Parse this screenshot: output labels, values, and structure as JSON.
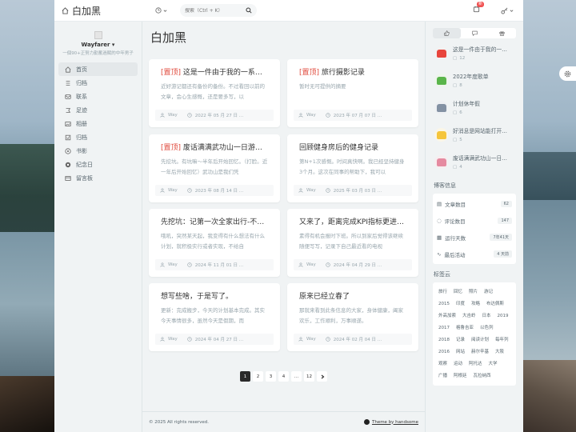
{
  "header": {
    "brand_title": "白加黑",
    "search_placeholder": "搜索（Ctrl + K）",
    "notification_count": "新"
  },
  "profile": {
    "name": "Wayfarer",
    "desc": "一個90+正努力勤奮過賦的中年男子"
  },
  "menu": [
    {
      "label": "首页",
      "icon": "home-icon"
    },
    {
      "label": "归档",
      "icon": "archive-icon"
    },
    {
      "label": "联系",
      "icon": "contact-icon"
    },
    {
      "label": "足迹",
      "icon": "footprint-icon"
    },
    {
      "label": "相册",
      "icon": "album-icon"
    },
    {
      "label": "归档",
      "icon": "archive-icon"
    },
    {
      "label": "书影",
      "icon": "book-icon"
    },
    {
      "label": "纪念日",
      "icon": "anniversary-icon"
    },
    {
      "label": "留言板",
      "icon": "message-icon"
    }
  ],
  "main": {
    "title": "白加黑",
    "posts": [
      {
        "pin": "[置顶]",
        "title": " 这是一件由于我的一系列…",
        "excerpt": "近好游记都还有备份的备份。不过看回以前的文章，会心生感慨，还是要多写，以",
        "author": "Way",
        "date": "2022 年 05 月 27 日 …"
      },
      {
        "pin": "[置顶]",
        "title": " 旅行摄影记录",
        "excerpt": "暂时无可提供的摘要",
        "author": "Way",
        "date": "2023 年 07 月 07 日 …"
      },
      {
        "pin": "[置顶]",
        "title": " 废话满满武功山一日游非…",
        "excerpt": "先挖坑。有坑嘛～半年后开始回忆。（打脸。近一年后开始回忆）武功山是我们凭",
        "author": "Way",
        "date": "2023 年 08 月 14 日 …"
      },
      {
        "pin": "",
        "title": "回顾健身房后的健身记录",
        "excerpt": "第N+1次感慨。时间真快啊。我已经坚持健身3个月。这次在同事的帮助下，我可以",
        "author": "Way",
        "date": "2025 年 03 月 03 日 …"
      },
      {
        "pin": "",
        "title": "先挖坑：记第一次全家出行-不…",
        "excerpt": "哦吼，突然某天起，我变得有什么想法有什么计划，就积极实行或者实现，不给自",
        "author": "Way",
        "date": "2024 年 11 月 01 日 …"
      },
      {
        "pin": "",
        "title": "又来了，距离完成KPI指标更进…",
        "excerpt": "素得有机会报时下班。所以到家后觉得该继续随便写写，记录下自己最近看的电视",
        "author": "Way",
        "date": "2024 年 04 月 29 日 …"
      },
      {
        "pin": "",
        "title": "想写些啥，于是写了。",
        "excerpt": "更新：完成搬步，今天的计划基本完成。其实今天事情很多，虽然今天是假期，而",
        "author": "Way",
        "date": "2024 年 04 月 27 日 …"
      },
      {
        "pin": "",
        "title": "原来已经立春了",
        "excerpt": "那就来看到此条信息的大家，身体健康，阖家欢乐，工作顺利，万事顺遂。",
        "author": "Way",
        "date": "2024 年 02 月 04 日 …"
      }
    ],
    "pages": [
      "1",
      "2",
      "3",
      "4",
      "...",
      "12"
    ],
    "footer_copy": "© 2025 All rights reserved.",
    "theme_link": "Theme by handsome"
  },
  "right": {
    "hot": [
      {
        "title": "这是一件由于我的一…",
        "count": "12",
        "color": "#e8453c",
        "bg": "#f2f2f2"
      },
      {
        "title": "2022年度歌单",
        "count": "8",
        "color": "#5ab54b",
        "bg": "#eef5ec"
      },
      {
        "title": "计划休年假",
        "count": "6",
        "color": "#8391a3",
        "bg": "#eef0f3"
      },
      {
        "title": "好消息是网站能打开…",
        "count": "5",
        "color": "#f5c53b",
        "bg": "#fbf6e6"
      },
      {
        "title": "废话满满武功山一日…",
        "count": "4",
        "color": "#e58aa0",
        "bg": "#f7eef0"
      }
    ],
    "info_title": "博客信息",
    "info": [
      {
        "label": "文章数目",
        "value": "62",
        "icon": "article-icon"
      },
      {
        "label": "评论数目",
        "value": "147",
        "icon": "comment-icon"
      },
      {
        "label": "运行天数",
        "value": "7年41天",
        "icon": "calendar-icon"
      },
      {
        "label": "最后活动",
        "value": "4 天前",
        "icon": "activity-icon"
      }
    ],
    "tags_title": "标签云",
    "tags": [
      "旅行",
      "回忆",
      "照片",
      "游记",
      "2015",
      "印度",
      "攻略",
      "布达佩斯",
      "外高加索",
      "大吉岭",
      "日本",
      "2019",
      "2017",
      "格鲁吉亚",
      "以色列",
      "2018",
      "记录",
      "阅读计划",
      "每年列",
      "2016",
      "网站",
      "赫尔辛基",
      "大阪",
      "观察",
      "运动",
      "阿托达",
      "大学",
      "广播",
      "阿根廷",
      "瓦拉纳西"
    ]
  }
}
